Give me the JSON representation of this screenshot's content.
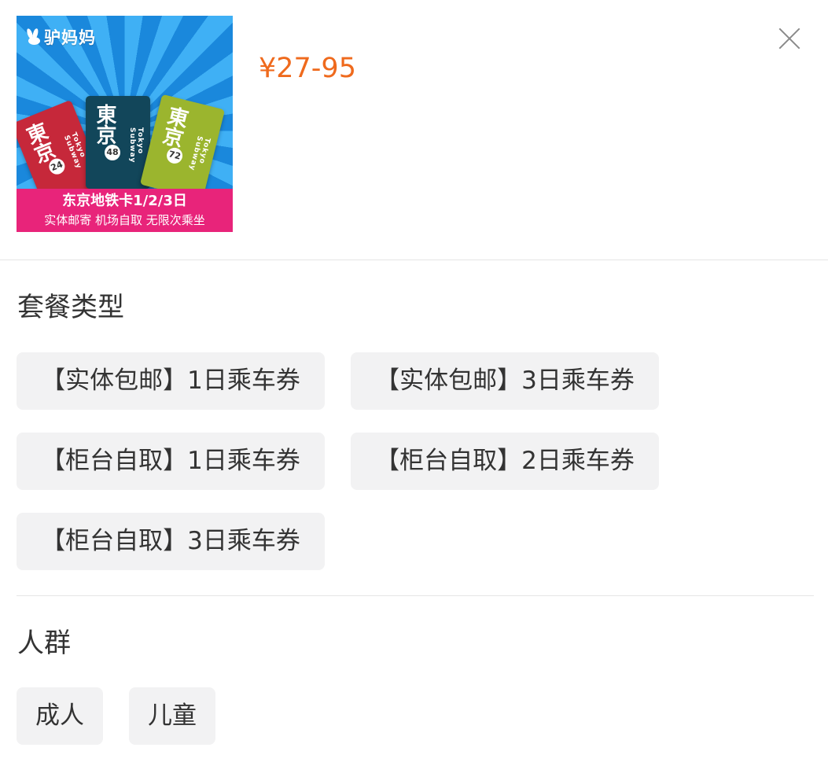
{
  "product": {
    "image": {
      "brand": "驴妈妈",
      "banner_title": "东京地铁卡1/2/3日",
      "banner_subtitle": "实体邮寄 机场自取 无限次乘坐",
      "cards": [
        {
          "kanji": "東京",
          "number": "24",
          "tag": "Tokyo Subway",
          "color": "#c6283a"
        },
        {
          "kanji": "東京",
          "number": "48",
          "tag": "Tokyo Subway",
          "color": "#12465a"
        },
        {
          "kanji": "東京",
          "number": "72",
          "tag": "Tokyo Subway",
          "color": "#9bb52e"
        }
      ]
    },
    "price": "¥27-95",
    "price_color": "#ef6a1d"
  },
  "package_type": {
    "title": "套餐类型",
    "options": [
      "【实体包邮】1日乘车券",
      "【实体包邮】3日乘车券",
      "【柜台自取】1日乘车券",
      "【柜台自取】2日乘车券",
      "【柜台自取】3日乘车券"
    ]
  },
  "audience": {
    "title": "人群",
    "options": [
      "成人",
      "儿童"
    ]
  },
  "icons": {
    "close": "close-icon"
  }
}
